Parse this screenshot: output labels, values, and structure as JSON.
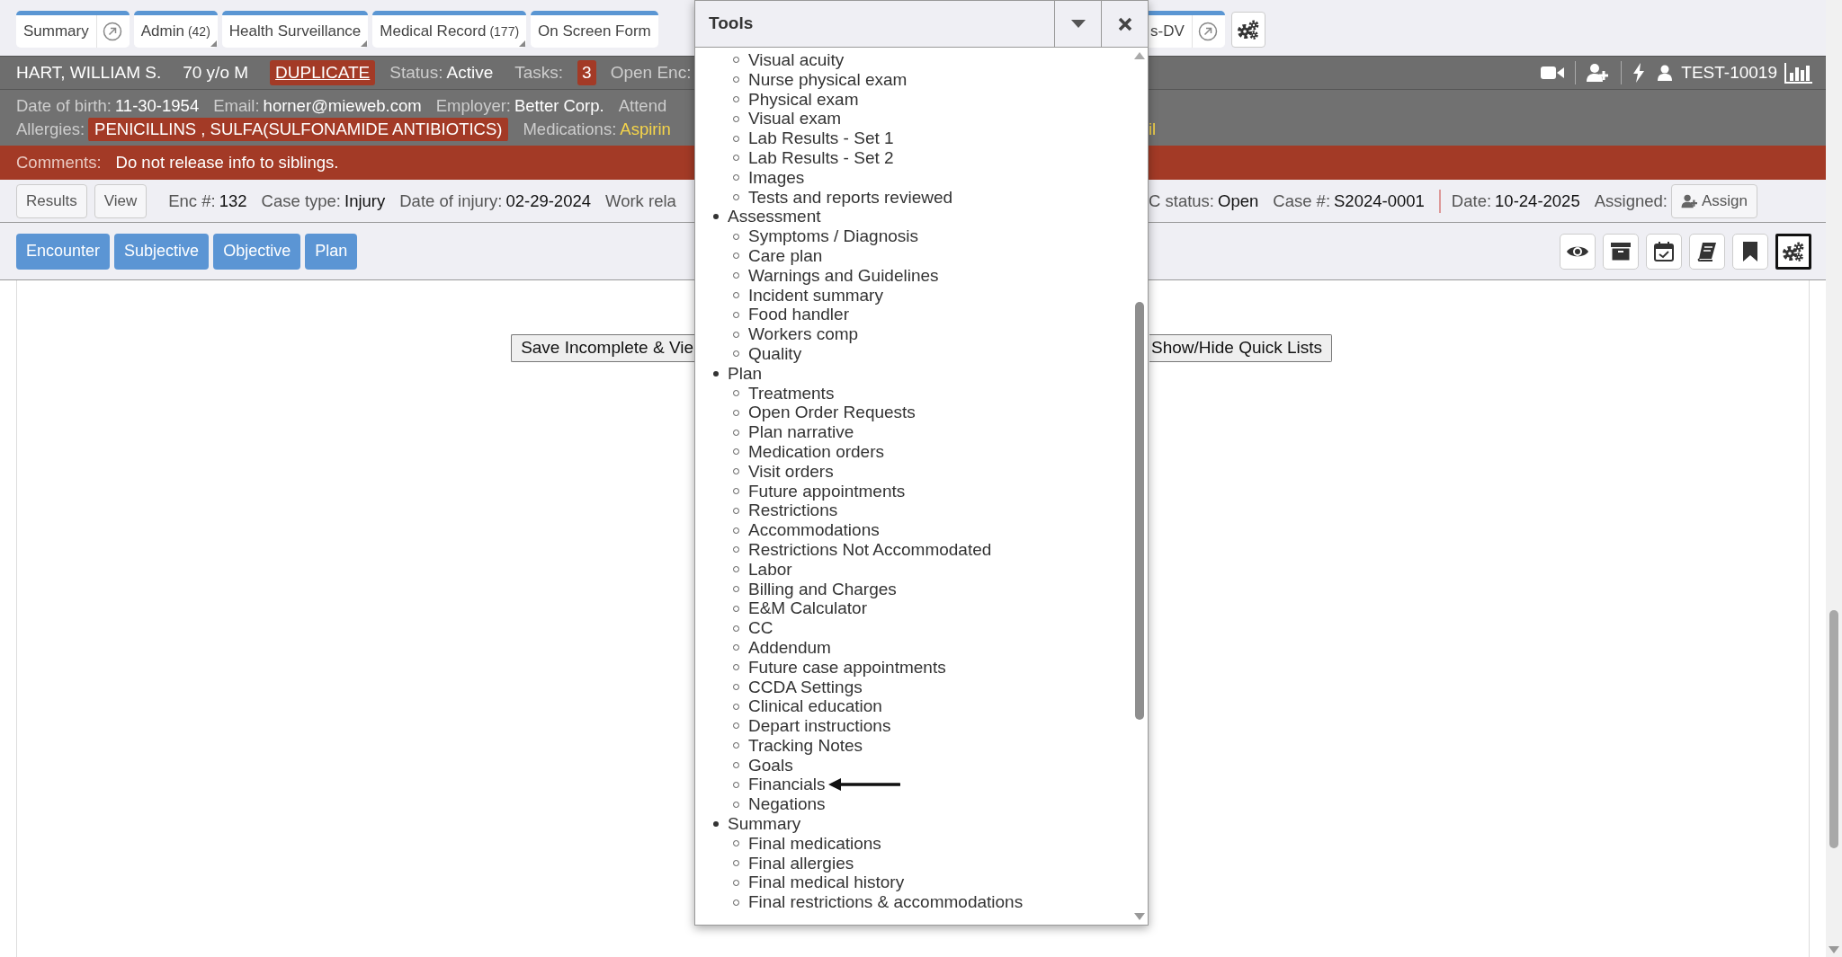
{
  "tabs": [
    {
      "label": "Summary",
      "external": true,
      "dropdown": false
    },
    {
      "label": "Admin",
      "count": "(42)",
      "external": false,
      "dropdown": true
    },
    {
      "label": "Health Surveillance",
      "external": false,
      "dropdown": true
    },
    {
      "label": "Medical Record",
      "count": "(177)",
      "external": false,
      "dropdown": true
    },
    {
      "label": "On Screen Form",
      "external": false,
      "dropdown": false
    }
  ],
  "right_tabs": [
    {
      "label": "s-DV",
      "external": true,
      "dropdown": false
    }
  ],
  "patient_bar": {
    "name": "HART, WILLIAM S.",
    "age_sex": "70 y/o M",
    "flag": "DUPLICATE",
    "status_label": "Status:",
    "status": "Active",
    "tasks_label": "Tasks:",
    "tasks": "3",
    "open_enc_label": "Open Enc:",
    "account": "TEST-10019"
  },
  "details": {
    "dob_label": "Date of birth:",
    "dob": "11-30-1954",
    "email_label": "Email:",
    "email": "horner@mieweb.com",
    "employer_label": "Employer:",
    "employer": "Better Corp.",
    "attend_label": "Attend",
    "allergies_label": "Allergies:",
    "allergies": "PENICILLINS , SULFA(SULFONAMIDE ANTIBIOTICS)",
    "medications_label": "Medications:",
    "medications": "Aspirin",
    "medications_tail": "il"
  },
  "comments": {
    "label": "Comments:",
    "text": "Do not release info to siblings."
  },
  "encounter_bar": {
    "buttons": [
      "Results",
      "View"
    ],
    "left_fields": [
      {
        "label": "Enc #:",
        "value": "132"
      },
      {
        "label": "Case type:",
        "value": "Injury"
      },
      {
        "label": "Date of injury:",
        "value": "02-29-2024"
      },
      {
        "label": "Work rela"
      }
    ],
    "right_fields": [
      {
        "label": "C status:",
        "value": "Open",
        "divider": false
      },
      {
        "label": "Case #:",
        "value": "S2024-0001",
        "divider": false
      },
      {
        "label": "Date:",
        "value": "10-24-2025",
        "divider": true
      }
    ],
    "assigned_label": "Assigned:",
    "assign_button": "Assign"
  },
  "section_tabs": [
    "Encounter",
    "Subjective",
    "Objective",
    "Plan"
  ],
  "toolbar": [
    {
      "kind": "eye",
      "selected": false
    },
    {
      "kind": "archive",
      "selected": false
    },
    {
      "kind": "calendar",
      "selected": false
    },
    {
      "kind": "book",
      "selected": false
    },
    {
      "kind": "bookmark",
      "selected": false
    },
    {
      "kind": "gears",
      "selected": true
    }
  ],
  "actions": [
    "Save Incomplete & Vie",
    "Show/Hide Quick Lists"
  ],
  "tools_menu": {
    "title": "Tools",
    "groups": [
      {
        "children": [
          {
            "label": "Visual acuity",
            "arrowed": false
          },
          {
            "label": "Nurse physical exam",
            "arrowed": false
          },
          {
            "label": "Physical exam",
            "arrowed": false
          },
          {
            "label": "Visual exam",
            "arrowed": false
          },
          {
            "label": "Lab Results - Set 1",
            "arrowed": false
          },
          {
            "label": "Lab Results - Set 2",
            "arrowed": false
          },
          {
            "label": "Images",
            "arrowed": false
          },
          {
            "label": "Tests and reports reviewed",
            "arrowed": false
          }
        ]
      },
      {
        "label": "Assessment",
        "children": [
          {
            "label": "Symptoms / Diagnosis",
            "arrowed": false
          },
          {
            "label": "Care plan",
            "arrowed": false
          },
          {
            "label": "Warnings and Guidelines",
            "arrowed": false
          },
          {
            "label": "Incident summary",
            "arrowed": false
          },
          {
            "label": "Food handler",
            "arrowed": false
          },
          {
            "label": "Workers comp",
            "arrowed": false
          },
          {
            "label": "Quality",
            "arrowed": false
          }
        ]
      },
      {
        "label": "Plan",
        "children": [
          {
            "label": "Treatments",
            "arrowed": false
          },
          {
            "label": "Open Order Requests",
            "arrowed": false
          },
          {
            "label": "Plan narrative",
            "arrowed": false
          },
          {
            "label": "Medication orders",
            "arrowed": false
          },
          {
            "label": "Visit orders",
            "arrowed": false
          },
          {
            "label": "Future appointments",
            "arrowed": false
          },
          {
            "label": "Restrictions",
            "arrowed": false
          },
          {
            "label": "Accommodations",
            "arrowed": false
          },
          {
            "label": "Restrictions Not Accommodated",
            "arrowed": false
          },
          {
            "label": "Labor",
            "arrowed": false
          },
          {
            "label": "Billing and Charges",
            "arrowed": false
          },
          {
            "label": "E&M Calculator",
            "arrowed": false
          },
          {
            "label": "CC",
            "arrowed": false
          },
          {
            "label": "Addendum",
            "arrowed": false
          },
          {
            "label": "Future case appointments",
            "arrowed": false
          },
          {
            "label": "CCDA Settings",
            "arrowed": false
          },
          {
            "label": "Clinical education",
            "arrowed": false
          },
          {
            "label": "Depart instructions",
            "arrowed": false
          },
          {
            "label": "Tracking Notes",
            "arrowed": false
          },
          {
            "label": "Goals",
            "arrowed": false
          },
          {
            "label": "Financials",
            "arrowed": true
          },
          {
            "label": "Negations",
            "arrowed": false
          }
        ]
      },
      {
        "label": "Summary",
        "children": [
          {
            "label": "Final medications",
            "arrowed": false
          },
          {
            "label": "Final allergies",
            "arrowed": false
          },
          {
            "label": "Final medical history",
            "arrowed": false
          },
          {
            "label": "Final restrictions & accommodations",
            "arrowed": false
          }
        ]
      }
    ]
  }
}
